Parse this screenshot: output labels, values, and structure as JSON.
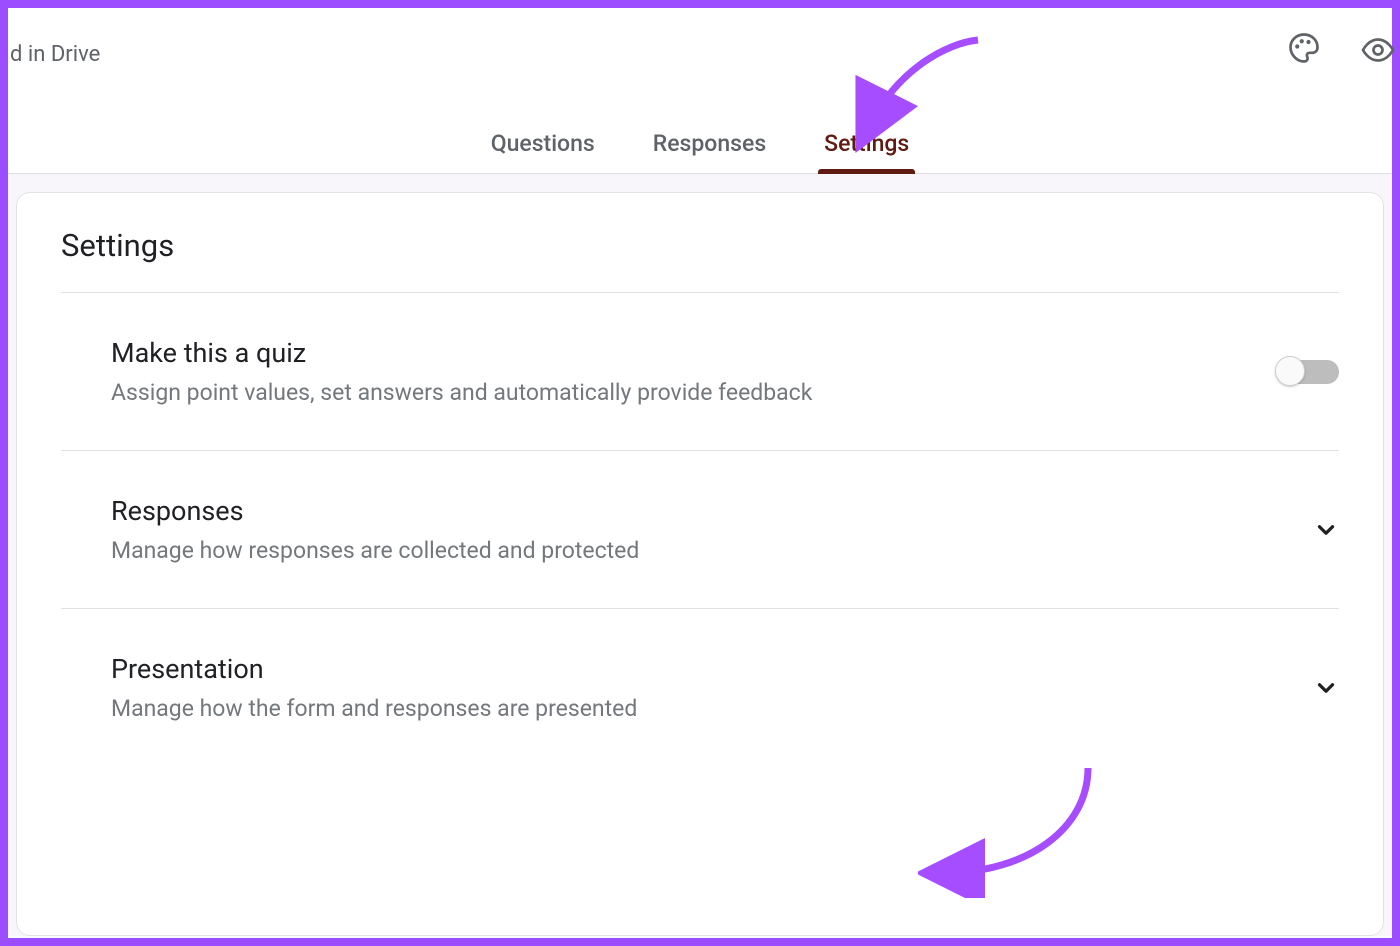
{
  "header": {
    "drive_text": "d in Drive"
  },
  "tabs": {
    "questions": "Questions",
    "responses": "Responses",
    "settings": "Settings"
  },
  "card": {
    "title": "Settings",
    "sections": {
      "quiz": {
        "title": "Make this a quiz",
        "desc": "Assign point values, set answers and automatically provide feedback",
        "enabled": false
      },
      "responses": {
        "title": "Responses",
        "desc": "Manage how responses are collected and protected"
      },
      "presentation": {
        "title": "Presentation",
        "desc": "Manage how the form and responses are presented"
      }
    }
  },
  "colors": {
    "annotation": "#a64dff"
  }
}
